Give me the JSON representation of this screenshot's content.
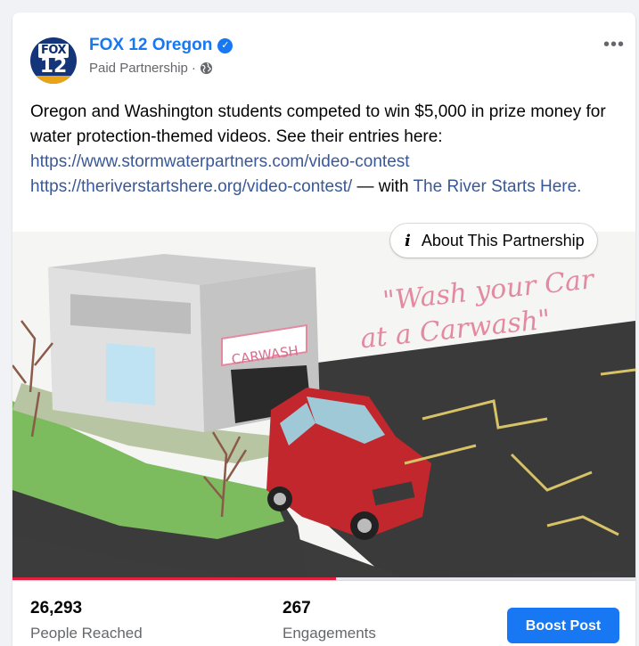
{
  "post": {
    "page_name": "FOX 12 Oregon",
    "sub_label": "Paid Partnership",
    "separator": "·",
    "avatar": {
      "logo_top": "FOX",
      "logo_number": "12"
    },
    "more_icon": "more-horizontal-icon",
    "text_main": "Oregon and Washington students competed to win $5,000 in prize money for water protection-themed videos. See their entries here:",
    "link_1": "https://www.stormwaterpartners.com/video-contest",
    "link_2": "https://theriverstartshere.org/video-contest/",
    "with_text": " — with ",
    "tagged_page": "The River Starts Here."
  },
  "media": {
    "about_partnership_label": "About This Partnership",
    "about_icon": "i",
    "sign_text": "CARWASH",
    "caption_line_1": "\"Wash your Car",
    "caption_line_2": "at a Carwash\"",
    "progress": 0.52
  },
  "stats": {
    "reached_value": "26,293",
    "reached_label": "People Reached",
    "engagements_value": "267",
    "engagements_label": "Engagements",
    "boost_label": "Boost Post"
  },
  "colors": {
    "brand_blue": "#1877f2",
    "link_blue": "#385898",
    "secondary_text": "#65676b",
    "progress_red": "#e41e3f"
  }
}
